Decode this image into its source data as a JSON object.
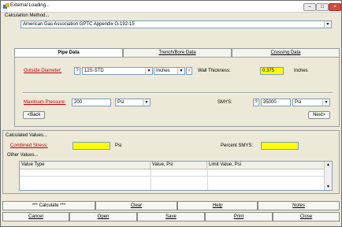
{
  "window": {
    "title": "External Loading..."
  },
  "calc_method": {
    "label": "Calculation Method...",
    "value": "American Gas Association GPTC Appendix G-192-15"
  },
  "tabs": [
    {
      "label": "Pipe Data",
      "active": true
    },
    {
      "label": "Trench/Bore Data",
      "active": false
    },
    {
      "label": "Crossing Data",
      "active": false
    }
  ],
  "pipe": {
    "od_label": "Outside Diameter:",
    "od_help": "?",
    "od_value": "12S-STD",
    "od_unit": "Inches",
    "info_btn": "i",
    "wall_label": "Wall Thickness:",
    "wall_value": "0.375",
    "wall_unit": "Inches",
    "maxp_label": "Maximum Pressure:",
    "maxp_value": "200",
    "maxp_unit": "Psi",
    "smys_label": "SMYS:",
    "smys_help": "?",
    "smys_value": "35000",
    "smys_unit": "Psi",
    "back": "<Back",
    "next": "Next>"
  },
  "calculated": {
    "label": "Calculated Values...",
    "combined_label": "Combined Stress:",
    "combined_value": "",
    "combined_unit": "Psi",
    "percent_label": "Percent SMYS:",
    "percent_value": "",
    "other_label": "Other Values...",
    "columns": [
      "Value Type",
      "Value, Psi",
      "Limit Value, Psi"
    ]
  },
  "buttons_row1": [
    "*** Calculate ***",
    "Clear",
    "Help",
    "Notes"
  ],
  "buttons_row2": [
    "Cancel",
    "Open",
    "Save",
    "Print",
    "Close"
  ],
  "colors": {
    "required_red": "#c00000",
    "highlight_yellow": "#ffff00"
  }
}
